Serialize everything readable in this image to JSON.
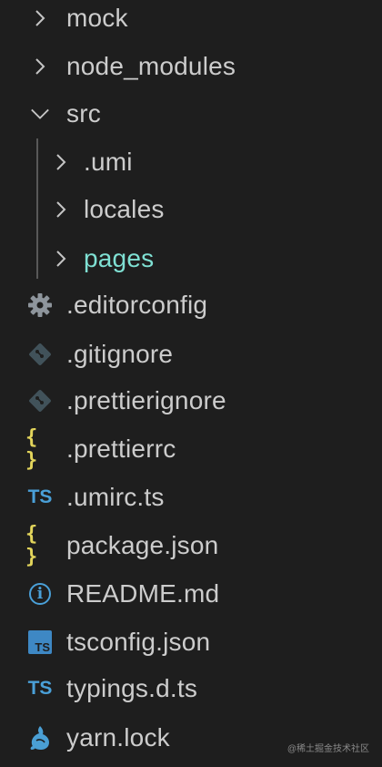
{
  "explorer": {
    "items": [
      {
        "label": "mock",
        "kind": "folder",
        "expanded": false,
        "icon": "chevron-right-icon"
      },
      {
        "label": "node_modules",
        "kind": "folder",
        "expanded": false,
        "icon": "chevron-right-icon"
      },
      {
        "label": "src",
        "kind": "folder",
        "expanded": true,
        "icon": "chevron-down-icon"
      },
      {
        "label": ".umi",
        "kind": "folder",
        "expanded": false,
        "icon": "chevron-right-icon"
      },
      {
        "label": "locales",
        "kind": "folder",
        "expanded": false,
        "icon": "chevron-right-icon"
      },
      {
        "label": "pages",
        "kind": "folder",
        "expanded": false,
        "icon": "chevron-right-icon",
        "color": "#7fe0d3"
      },
      {
        "label": ".editorconfig",
        "kind": "file",
        "icon": "gear-icon",
        "icon_color": "#8e959c"
      },
      {
        "label": ".gitignore",
        "kind": "file",
        "icon": "git-icon",
        "icon_color": "#41525a"
      },
      {
        "label": ".prettierignore",
        "kind": "file",
        "icon": "git-icon",
        "icon_color": "#41525a"
      },
      {
        "label": ".prettierrc",
        "kind": "file",
        "icon": "json-braces-icon",
        "icon_glyph": "{ }",
        "icon_color": "#e3d55b"
      },
      {
        "label": ".umirc.ts",
        "kind": "file",
        "icon": "typescript-icon",
        "icon_glyph": "TS",
        "icon_color": "#4aa0d8"
      },
      {
        "label": "package.json",
        "kind": "file",
        "icon": "json-braces-icon",
        "icon_glyph": "{ }",
        "icon_color": "#e3d55b"
      },
      {
        "label": "README.md",
        "kind": "file",
        "icon": "info-icon",
        "icon_glyph": "i",
        "icon_color": "#4aa0d8"
      },
      {
        "label": "tsconfig.json",
        "kind": "file",
        "icon": "tsconfig-icon",
        "icon_glyph": "TS",
        "icon_color": "#3e88c4"
      },
      {
        "label": "typings.d.ts",
        "kind": "file",
        "icon": "typescript-icon",
        "icon_glyph": "TS",
        "icon_color": "#4aa0d8"
      },
      {
        "label": "yarn.lock",
        "kind": "file",
        "icon": "yarn-icon",
        "icon_color": "#4a9fd4"
      }
    ]
  },
  "watermark": "@稀土掘金技术社区",
  "colors": {
    "background": "#1e1e1e",
    "text": "#cccccc",
    "accent_folder": "#7fe0d3",
    "indent_guide": "#585858"
  }
}
